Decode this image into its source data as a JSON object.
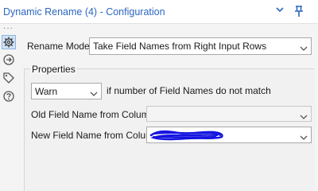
{
  "window": {
    "title": "Dynamic Rename (4) - Configuration",
    "icons": [
      "chevron-down-icon",
      "pin-icon"
    ]
  },
  "toolstrip": {
    "icons": [
      "settings-icon",
      "connection-icon",
      "tag-icon",
      "help-icon"
    ],
    "selected": "settings-icon"
  },
  "form": {
    "rename_mode": {
      "label": "Rename Mode:",
      "value": "Take Field Names from Right Input Rows"
    },
    "properties": {
      "title": "Properties",
      "mismatch_select": {
        "value": "Warn"
      },
      "mismatch_text": "if number of Field Names do not match",
      "old_field": {
        "label": "Old Field Name from Column",
        "value": ""
      },
      "new_field": {
        "label": "New Field Name from Column",
        "value": ""
      }
    }
  },
  "colors": {
    "title_text": "#2b66c0",
    "scribble": "#1515e0"
  }
}
